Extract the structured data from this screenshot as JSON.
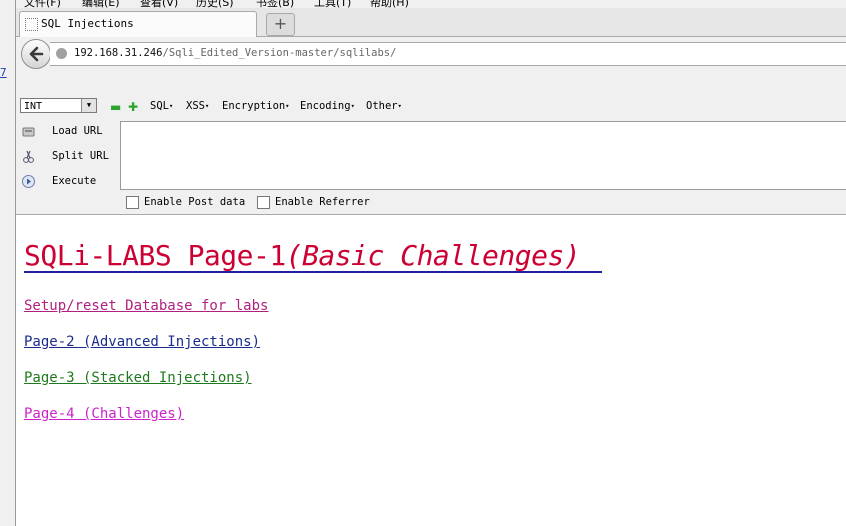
{
  "menubar": {
    "items": [
      "文件(F)",
      "编辑(E)",
      "查看(V)",
      "历史(S)",
      "书签(B)",
      "工具(T)",
      "帮助(H)"
    ]
  },
  "tab": {
    "title": "SQL Injections",
    "new_tab_label": "+"
  },
  "navbar": {
    "url_host": "192.168.31.246",
    "url_path": "/Sqli_Edited_Version-master/sqlilabs/"
  },
  "hackbar": {
    "select_value": "INT",
    "menus": [
      "SQL",
      "XSS",
      "Encryption",
      "Encoding",
      "Other"
    ],
    "actions": [
      "Load URL",
      "Split URL",
      "Execute"
    ],
    "checkboxes": [
      "Enable Post data",
      "Enable Referrer"
    ]
  },
  "page": {
    "title_main": "SQLi-LABS Page-1",
    "title_sub": "(Basic Challenges)",
    "links": [
      {
        "label": "Setup/reset Database for labs",
        "color": "#b0207e"
      },
      {
        "label": "Page-2 (Advanced Injections)",
        "color": "#1a2c8c"
      },
      {
        "label": "Page-3 (Stacked Injections)",
        "color": "#1e7a1e"
      },
      {
        "label": "Page-4 (Challenges)",
        "color": "#cc22cc"
      }
    ],
    "title_color": "#cc0033"
  },
  "gutter": {
    "mark": "7"
  }
}
